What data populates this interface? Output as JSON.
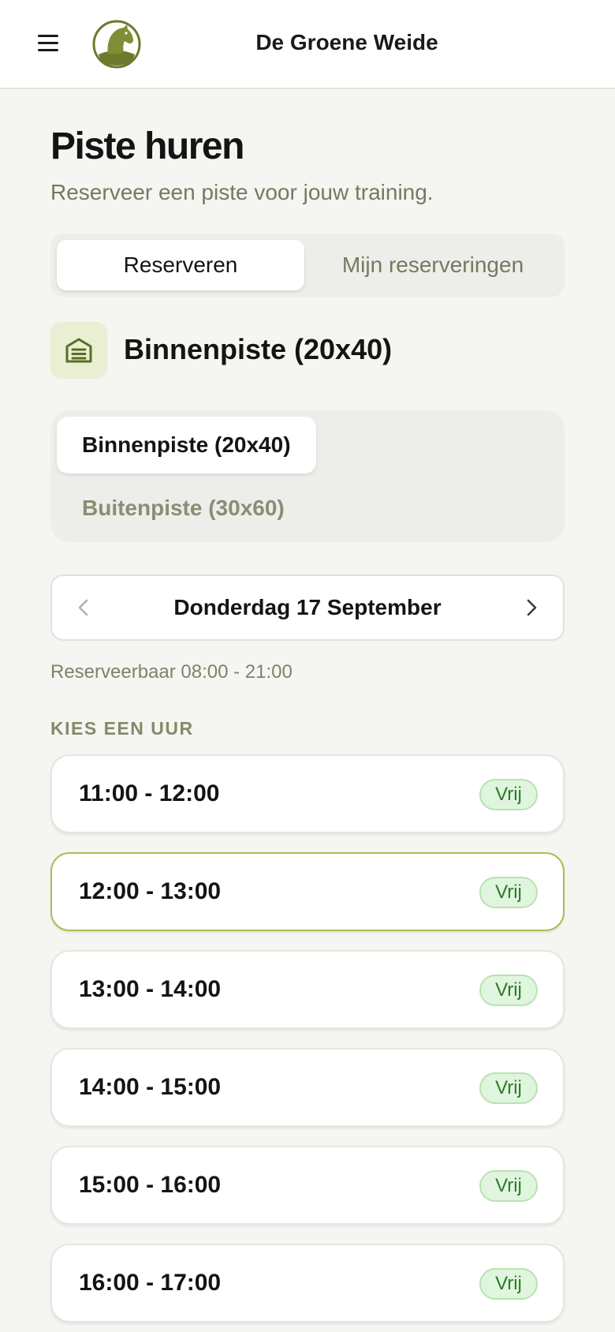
{
  "header": {
    "app_title": "De Groene Weide",
    "menu_icon": "hamburger-menu-icon",
    "logo_icon": "horse-logo-icon"
  },
  "page": {
    "title": "Piste huren",
    "subtitle": "Reserveer een piste voor jouw training."
  },
  "tabs": [
    {
      "label": "Reserveren",
      "active": true
    },
    {
      "label": "Mijn reserveringen",
      "active": false
    }
  ],
  "arena": {
    "icon": "arena-building-icon",
    "selected_label": "Binnenpiste (20x40)",
    "options": [
      {
        "label": "Binnenpiste (20x40)",
        "selected": true
      },
      {
        "label": "Buitenpiste (30x60)",
        "selected": false
      }
    ]
  },
  "date": {
    "label": "Donderdag 17 September",
    "prev_icon": "chevron-left-icon",
    "next_icon": "chevron-right-icon"
  },
  "hours_note": "Reserveerbaar 08:00 - 21:00",
  "section_label": "KIES EEN UUR",
  "slots": [
    {
      "time": "11:00 - 12:00",
      "status": "Vrij",
      "selected": false
    },
    {
      "time": "12:00 - 13:00",
      "status": "Vrij",
      "selected": true
    },
    {
      "time": "13:00 - 14:00",
      "status": "Vrij",
      "selected": false
    },
    {
      "time": "14:00 - 15:00",
      "status": "Vrij",
      "selected": false
    },
    {
      "time": "15:00 - 16:00",
      "status": "Vrij",
      "selected": false
    },
    {
      "time": "16:00 - 17:00",
      "status": "Vrij",
      "selected": false
    }
  ],
  "colors": {
    "accent": "#a9c04f",
    "badge_bg": "#e0f5dd",
    "badge_text": "#2d7a2a",
    "muted_text": "#77795f"
  }
}
